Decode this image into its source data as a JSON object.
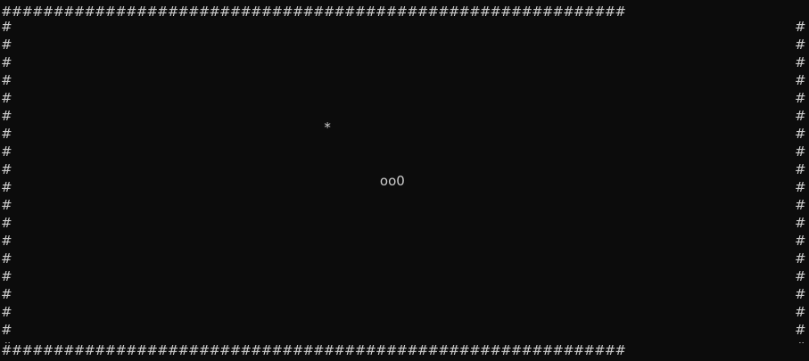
{
  "board": {
    "wall_char": "#",
    "food_char": "*",
    "snake_text": "oo0",
    "cols": 60,
    "rows": 20,
    "food": {
      "col": 24,
      "row": 6
    },
    "snake_head": {
      "col": 29,
      "row": 9
    },
    "colors": {
      "background": "#0c0c0c",
      "foreground": "#cccccc"
    }
  }
}
